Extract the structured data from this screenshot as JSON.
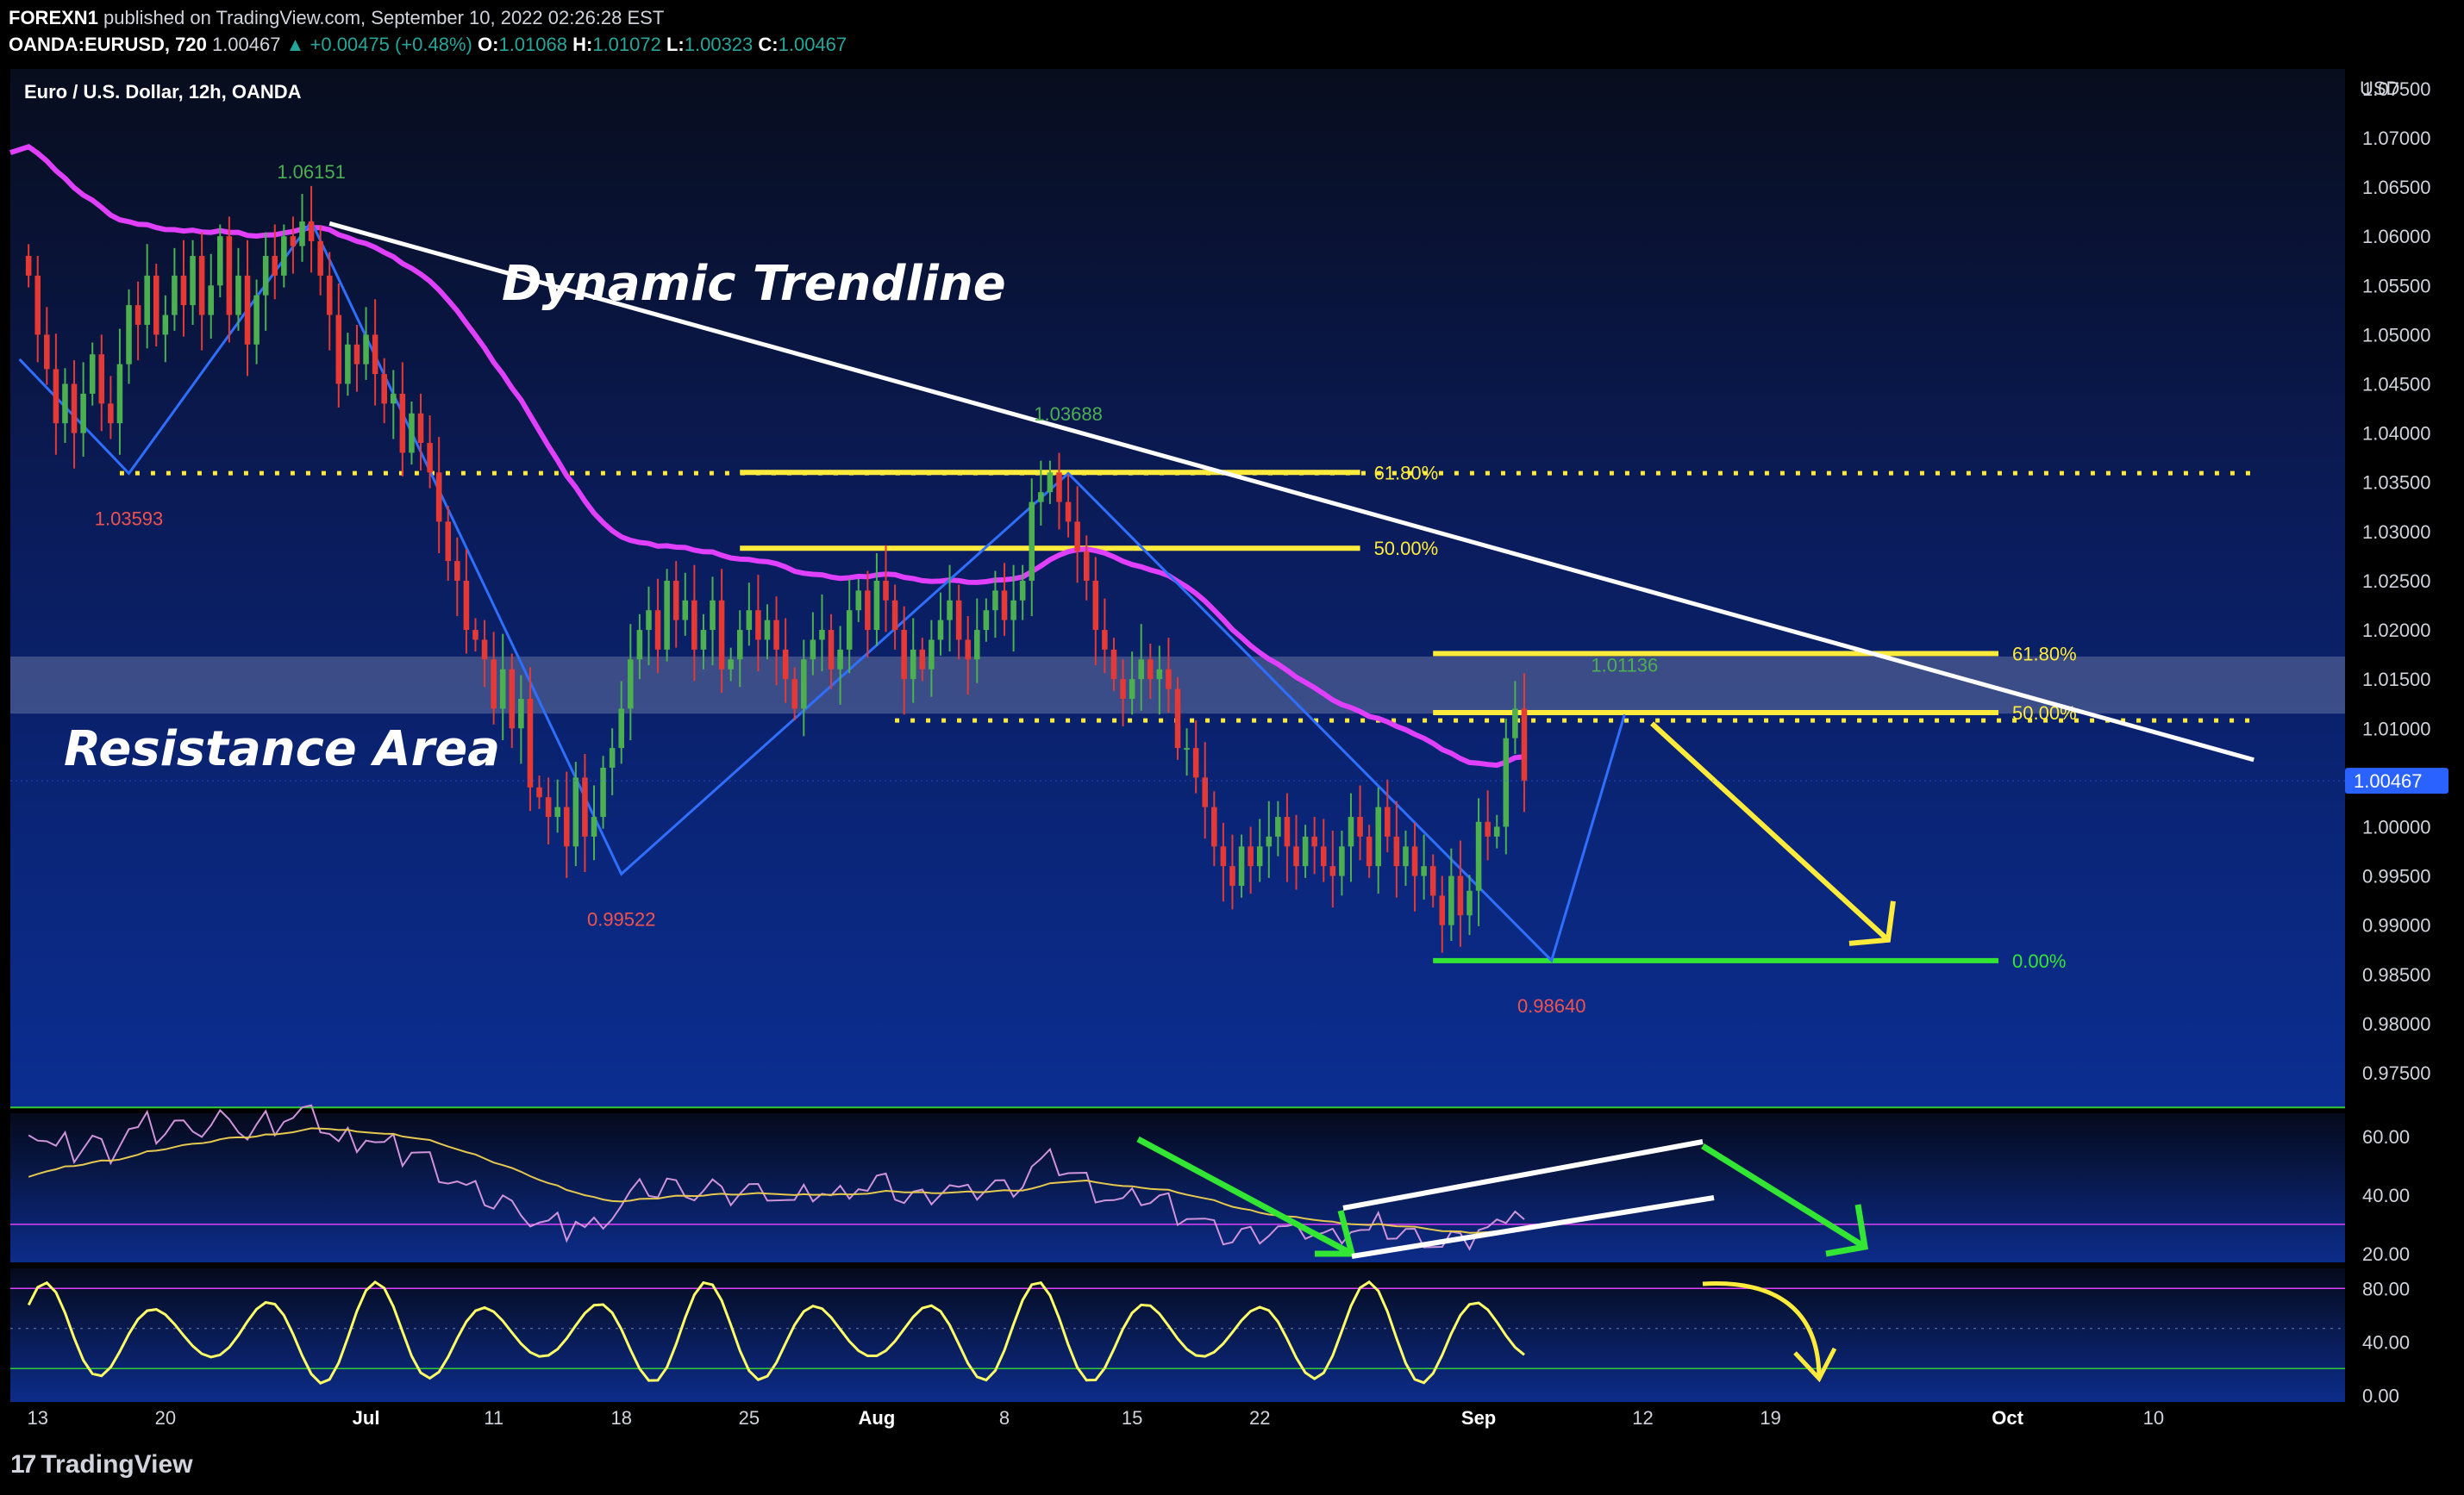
{
  "header": {
    "publisher": "FOREXN1",
    "published_text": "published on TradingView.com, September 10, 2022 02:26:28 EST",
    "symbol": "OANDA:EURUSD, 720",
    "last": "1.00467",
    "change": "▲ +0.00475 (+0.48%)",
    "o_label": "O:",
    "o": "1.01068",
    "h_label": "H:",
    "h": "1.01072",
    "l_label": "L:",
    "l": "1.00323",
    "c_label": "C:",
    "c": "1.00467"
  },
  "footer": {
    "brand": "TradingView",
    "logo_icon": "tradingview-logo-icon"
  },
  "colors": {
    "background": "#000000",
    "panel_top": "#0a0f22",
    "panel_bottom": "#0b2c88",
    "up": "#4caf50",
    "down": "#e53935",
    "ma": "#e040fb",
    "fib": "#ffeb3b",
    "zero_line": "#33e633",
    "trend": "#ffffff",
    "zigzag": "#2f6fff",
    "price_tag": "#2962ff",
    "high_label": "#4caf50",
    "low_label": "#ef5350"
  },
  "chart_data": [
    {
      "type": "candlestick",
      "title": "Euro / U.S. Dollar, 12h, OANDA",
      "y_unit": "USD",
      "ylim": [
        0.9715,
        1.077
      ],
      "y_ticks": [
        "1.07500",
        "1.07000",
        "1.06500",
        "1.06000",
        "1.05500",
        "1.05000",
        "1.04500",
        "1.04000",
        "1.03500",
        "1.03000",
        "1.02500",
        "1.02000",
        "1.01500",
        "1.01000",
        "1.00500",
        "1.00000",
        "0.99500",
        "0.99000",
        "0.98500",
        "0.98000",
        "0.97500"
      ],
      "x_ticks": [
        {
          "label": "13",
          "bar": 1
        },
        {
          "label": "20",
          "bar": 15
        },
        {
          "label": "Jul",
          "bar": 37
        },
        {
          "label": "11",
          "bar": 51
        },
        {
          "label": "18",
          "bar": 65
        },
        {
          "label": "25",
          "bar": 79
        },
        {
          "label": "Aug",
          "bar": 93
        },
        {
          "label": "8",
          "bar": 107
        },
        {
          "label": "15",
          "bar": 121
        },
        {
          "label": "22",
          "bar": 135
        },
        {
          "label": "Sep",
          "bar": 159
        },
        {
          "label": "12",
          "bar": 177
        },
        {
          "label": "19",
          "bar": 191
        },
        {
          "label": "Oct",
          "bar": 217
        },
        {
          "label": "10",
          "bar": 233
        }
      ],
      "x_range_bars": [
        -2,
        254
      ],
      "last_price": "1.00467",
      "closes": [
        1.056,
        1.05,
        1.0465,
        1.041,
        1.045,
        1.04,
        1.044,
        1.048,
        1.043,
        1.041,
        1.047,
        1.053,
        1.051,
        1.056,
        1.05,
        1.052,
        1.056,
        1.053,
        1.058,
        1.052,
        1.055,
        1.06,
        1.052,
        1.056,
        1.049,
        1.054,
        1.058,
        1.056,
        1.06,
        1.059,
        1.0615,
        1.0595,
        1.056,
        1.052,
        1.045,
        1.049,
        1.047,
        1.05,
        1.046,
        1.043,
        1.044,
        1.038,
        1.042,
        1.039,
        1.036,
        1.031,
        1.027,
        1.025,
        1.02,
        1.019,
        1.017,
        1.012,
        1.016,
        1.01,
        1.013,
        1.004,
        1.003,
        1.001,
        1.002,
        0.998,
        1.005,
        0.999,
        1.001,
        1.006,
        1.008,
        1.012,
        1.017,
        1.02,
        1.022,
        1.018,
        1.025,
        1.021,
        1.023,
        1.018,
        1.02,
        1.023,
        1.016,
        1.017,
        1.02,
        1.022,
        1.019,
        1.021,
        1.018,
        1.015,
        1.012,
        1.017,
        1.019,
        1.02,
        1.016,
        1.018,
        1.022,
        1.024,
        1.02,
        1.025,
        1.023,
        1.02,
        1.015,
        1.018,
        1.016,
        1.019,
        1.021,
        1.023,
        1.019,
        1.017,
        1.02,
        1.022,
        1.024,
        1.021,
        1.023,
        1.025,
        1.033,
        1.034,
        1.036,
        1.033,
        1.031,
        1.028,
        1.025,
        1.02,
        1.018,
        1.015,
        1.013,
        1.015,
        1.017,
        1.015,
        1.016,
        1.014,
        1.008,
        1.008,
        1.005,
        1.002,
        0.998,
        0.996,
        0.994,
        0.998,
        0.996,
        0.998,
        0.999,
        1.001,
        0.998,
        0.996,
        0.999,
        0.998,
        0.996,
        0.995,
        0.998,
        1.001,
        0.999,
        0.996,
        1.002,
        0.999,
        0.996,
        0.998,
        0.995,
        0.996,
        0.993,
        0.99,
        0.995,
        0.991,
        0.9935,
        1.0005,
        0.999,
        1.0,
        1.009,
        1.012,
        1.0047
      ],
      "series": [
        {
          "name": "MA",
          "values_description": "moving average",
          "color": "#e040fb"
        }
      ],
      "annotations": {
        "dynamic_trendline_label": "Dynamic Trendline",
        "resistance_label": "Resistance Area",
        "resistance_zone": [
          1.0115,
          1.0173
        ],
        "trendline": [
          {
            "bar": 33,
            "price": 1.0613
          },
          {
            "bar": 244,
            "price": 1.0068
          }
        ],
        "dotted_levels": [
          {
            "price": 1.03593,
            "from_bar": 10,
            "to_bar": 244
          },
          {
            "price": 1.0108,
            "from_bar": 95,
            "to_bar": 244
          }
        ],
        "fib_upper": [
          {
            "label": "61.80%",
            "price": 1.036,
            "from_bar": 78,
            "to_bar": 146
          },
          {
            "label": "50.00%",
            "price": 1.0283,
            "from_bar": 78,
            "to_bar": 146
          }
        ],
        "fib_lower": [
          {
            "label": "61.80%",
            "price": 1.0176,
            "from_bar": 154,
            "to_bar": 216
          },
          {
            "label": "50.00%",
            "price": 1.0116,
            "from_bar": 154,
            "to_bar": 216
          },
          {
            "label": "0.00%",
            "price": 0.9864,
            "from_bar": 154,
            "to_bar": 216,
            "color": "#33e633"
          }
        ],
        "peaks": [
          {
            "label": "1.06151",
            "bar": 31,
            "price": 1.0615,
            "kind": "high"
          },
          {
            "label": "1.03593",
            "bar": 11,
            "price": 1.0359,
            "kind": "low"
          },
          {
            "label": "1.03688",
            "bar": 114,
            "price": 1.0369,
            "kind": "high"
          },
          {
            "label": "0.99522",
            "bar": 65,
            "price": 0.9952,
            "kind": "low"
          },
          {
            "label": "1.01136",
            "bar": 175,
            "price": 1.0114,
            "kind": "high"
          },
          {
            "label": "0.98640",
            "bar": 167,
            "price": 0.9864,
            "kind": "low"
          }
        ],
        "zigzag": [
          {
            "bar": -1,
            "price": 1.0475
          },
          {
            "bar": 11,
            "price": 1.0359
          },
          {
            "bar": 31,
            "price": 1.0615
          },
          {
            "bar": 65,
            "price": 0.9952
          },
          {
            "bar": 114,
            "price": 1.0359
          },
          {
            "bar": 167,
            "price": 0.9864
          },
          {
            "bar": 175,
            "price": 1.0114
          }
        ],
        "yellow_arrow": [
          {
            "bar": 178,
            "price": 1.0105
          },
          {
            "bar": 202,
            "price": 0.9885
          }
        ]
      }
    },
    {
      "type": "line",
      "title": "",
      "ylim": [
        17,
        68
      ],
      "y_ticks": [
        "60.00",
        "40.00",
        "20.00"
      ],
      "levels": [
        70,
        30
      ],
      "series": [
        {
          "name": "",
          "color": "#ce93d8"
        },
        {
          "name": "",
          "color": "#e6c84f"
        }
      ]
    },
    {
      "type": "line",
      "title": "",
      "ylim": [
        -5,
        95
      ],
      "y_ticks": [
        "80.00",
        "40.00",
        "0.00"
      ],
      "levels": [
        80,
        20
      ],
      "series": [
        {
          "name": "",
          "color": "#ffff66"
        }
      ]
    }
  ]
}
